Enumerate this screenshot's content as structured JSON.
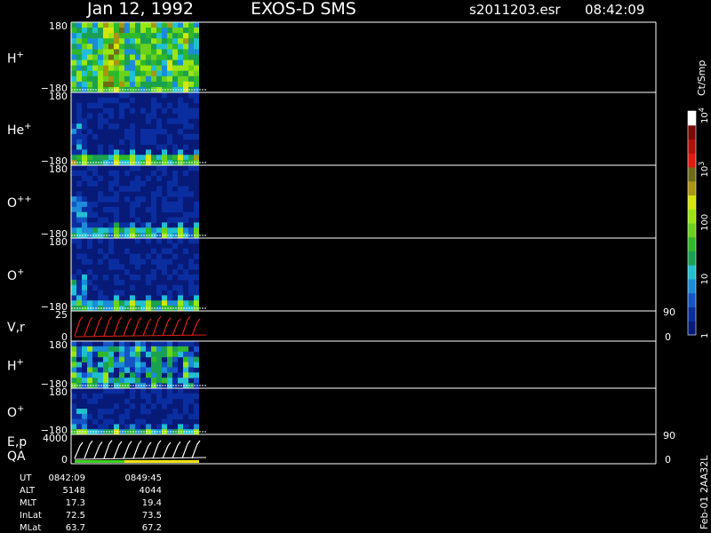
{
  "header": {
    "date": "Jan 12, 1992",
    "mission": "EXOS-D SMS",
    "file": "s2011203.esr",
    "time": "08:42:09"
  },
  "colorbar": {
    "unit": "Ct/Smp",
    "ticks": [
      {
        "base": "10",
        "exp": "4",
        "v": 10000
      },
      {
        "base": "10",
        "exp": "3",
        "v": 1000
      },
      {
        "base": "100",
        "exp": "",
        "v": 100
      },
      {
        "base": "10",
        "exp": "",
        "v": 10
      },
      {
        "base": "1",
        "exp": "",
        "v": 1
      }
    ],
    "colors": [
      "#071a78",
      "#0a2ea0",
      "#1454c4",
      "#1a8cd8",
      "#21c0d0",
      "#19a050",
      "#2fb82a",
      "#6ad21c",
      "#9ae612",
      "#d6e40c",
      "#a89610",
      "#6e6c16",
      "#e01a10",
      "#b01008",
      "#7c0804",
      "#ffffff"
    ]
  },
  "chart_data": {
    "type": "heatmap",
    "panels": [
      {
        "label": "H",
        "sup": "+",
        "ymax_label": "180",
        "ymin_label": "−180",
        "ylim": [
          -180,
          180
        ],
        "profile": "hplus",
        "intensity": 0.95
      },
      {
        "label": "He",
        "sup": "+",
        "ymax_label": "180",
        "ymin_label": "−180",
        "ylim": [
          -180,
          180
        ],
        "profile": "minor",
        "intensity": 0.35
      },
      {
        "label": "O",
        "sup": "++",
        "ymax_label": "180",
        "ymin_label": "−180",
        "ylim": [
          -180,
          180
        ],
        "profile": "minor",
        "intensity": 0.25
      },
      {
        "label": "O",
        "sup": "+",
        "ymax_label": "180",
        "ymin_label": "−180",
        "ylim": [
          -180,
          180
        ],
        "profile": "minor",
        "intensity": 0.3
      },
      {
        "label": "V,r",
        "sup": "",
        "ymax_label": "25",
        "ymin_label": "0",
        "right_top": "90",
        "right_bottom": "0",
        "ylim": [
          0,
          25
        ],
        "profile": "line_red"
      },
      {
        "label": "H",
        "sup": "+",
        "ymax_label": "180",
        "ymin_label": "−180",
        "ylim": [
          -180,
          180
        ],
        "profile": "hplus2",
        "intensity": 0.55
      },
      {
        "label": "O",
        "sup": "+",
        "ymax_label": "180",
        "ymin_label": "−180",
        "ylim": [
          -180,
          180
        ],
        "profile": "minor",
        "intensity": 0.3
      },
      {
        "label": "E,p",
        "label2": "QA",
        "sup": "",
        "ymax_label": "4000",
        "ymin_label": "0",
        "right_top": "90",
        "right_bottom": "0",
        "ylim": [
          0,
          4000
        ],
        "profile": "line_white"
      }
    ],
    "time_range": [
      "0842:09",
      "0849:45"
    ]
  },
  "orbit": {
    "rows": [
      {
        "label": "UT",
        "v1": "0842:09",
        "v2": "0849:45"
      },
      {
        "label": "ALT",
        "v1": "5148",
        "v2": "4044"
      },
      {
        "label": "MLT",
        "v1": "17.3",
        "v2": "19.4"
      },
      {
        "label": "InLat",
        "v1": "72.5",
        "v2": "73.5"
      },
      {
        "label": "MLat",
        "v1": "63.7",
        "v2": "67.2"
      }
    ]
  },
  "sidebar": {
    "version": "Feb-01 2AA32L"
  }
}
